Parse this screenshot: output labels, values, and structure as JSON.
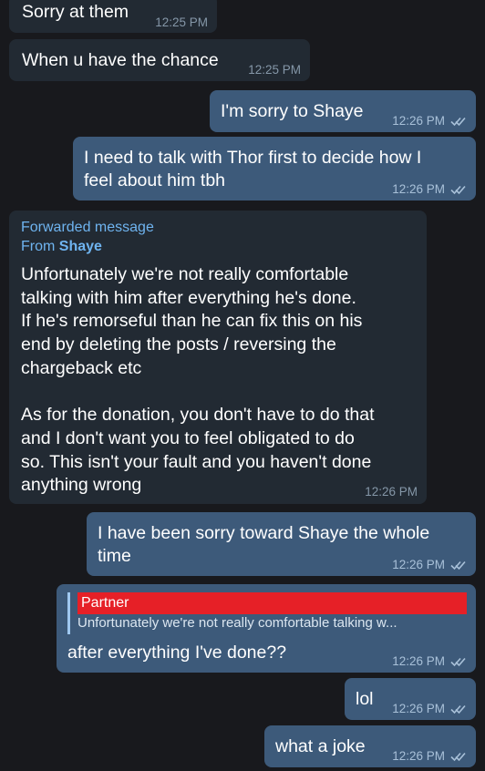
{
  "messages": [
    {
      "text": "Sorry at them",
      "time": "12:25 PM"
    },
    {
      "text": "When u have the chance",
      "time": "12:25 PM"
    },
    {
      "text": "I'm sorry to Shaye",
      "time": "12:26 PM"
    },
    {
      "text": "I need to talk with Thor first to decide how I\nfeel about him tbh",
      "time": "12:26 PM"
    },
    {
      "forwarded_label": "Forwarded message",
      "from_prefix": "From",
      "from_name": "Shaye",
      "text": "Unfortunately we're not really comfortable\ntalking with him after everything he's done.\nIf he's remorseful than he can fix this on his\nend by deleting the posts / reversing the\nchargeback etc\n\nAs for the donation, you don't have to do that\nand I don't want you to feel obligated to do\nso. This isn't your fault and you haven't done\nanything wrong",
      "time": "12:26 PM"
    },
    {
      "text": "I have been sorry toward Shaye the whole\ntime",
      "time": "12:26 PM"
    },
    {
      "reply_name": "Partner",
      "reply_snippet": "Unfortunately we're not really comfortable talking w...",
      "text": "after everything I've done??",
      "time": "12:26 PM"
    },
    {
      "text": "lol",
      "time": "12:26 PM"
    },
    {
      "text": "what a joke",
      "time": "12:26 PM"
    }
  ],
  "icons": {
    "read_receipt": "double-check-icon"
  },
  "colors": {
    "background": "#18191d",
    "incoming_bubble": "#222a33",
    "outgoing_bubble": "#3d5a7a",
    "link_blue": "#6fb4f0",
    "reply_name_highlight": "#e62027"
  }
}
